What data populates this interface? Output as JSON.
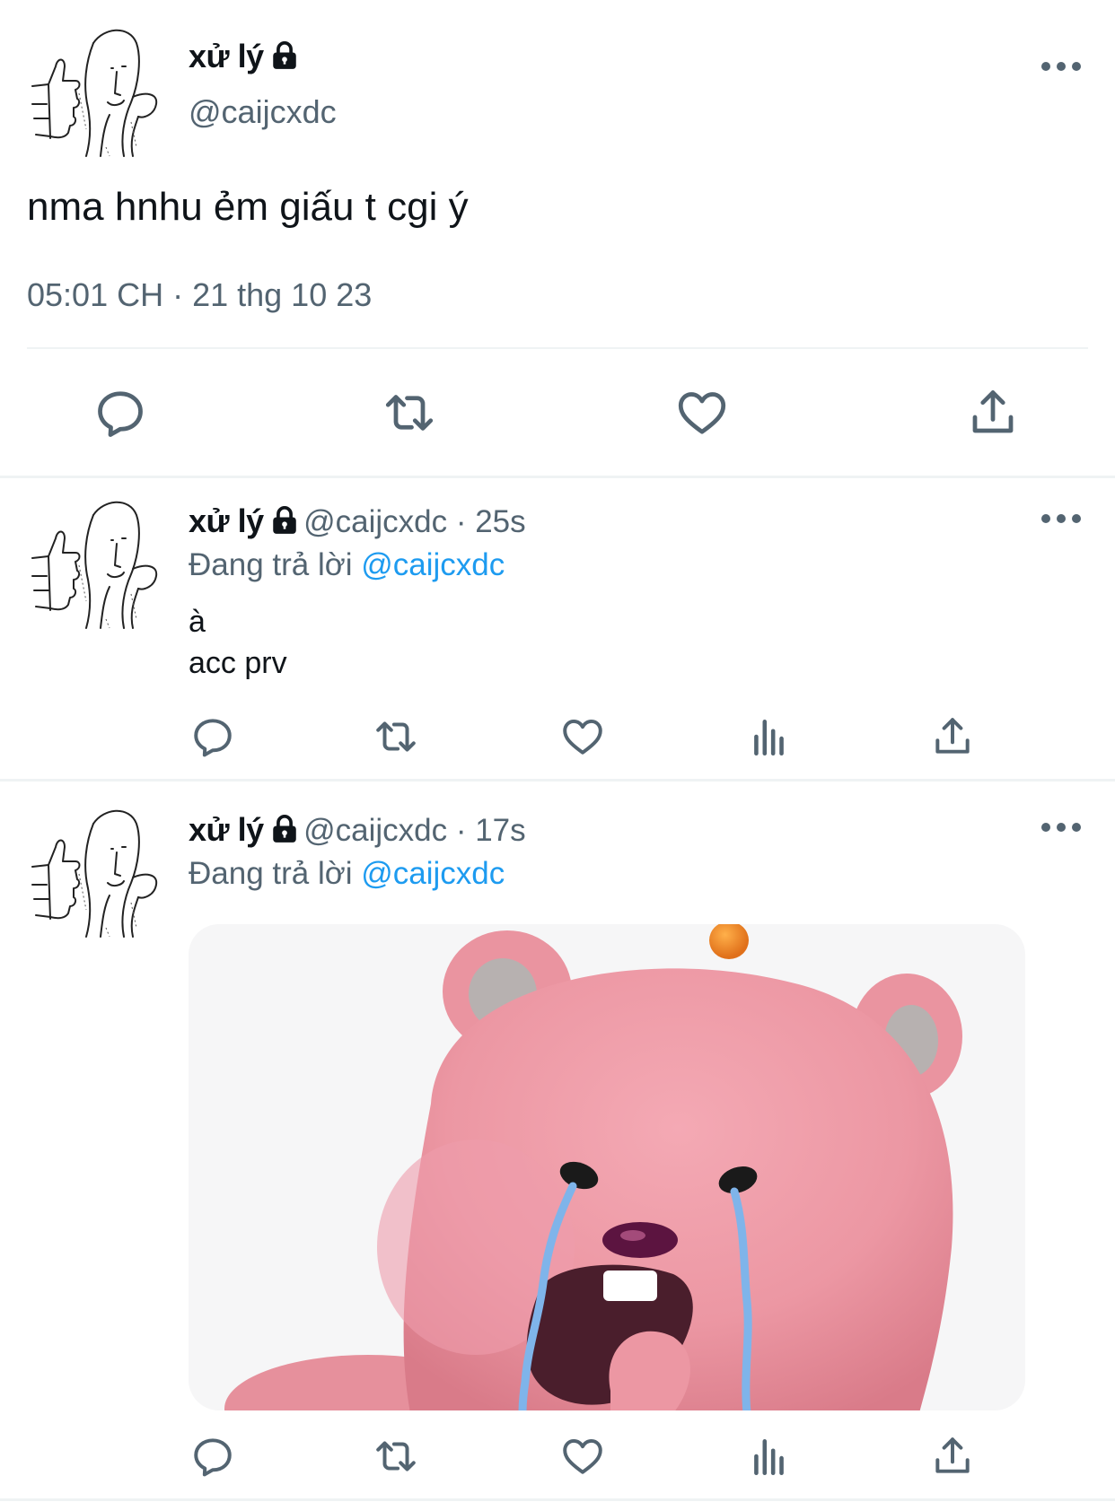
{
  "main_tweet": {
    "display_name": "xử lý",
    "handle": "@caijcxdc",
    "text": "nma hnhu ẻm giấu t cgi ý",
    "time": "05:01 CH",
    "date": "21 thg 10 23"
  },
  "replies": [
    {
      "display_name": "xử lý",
      "handle": "@caijcxdc",
      "age": "25s",
      "replying_prefix": "Đang trả lời",
      "replying_to": "@caijcxdc",
      "text_lines": [
        "à",
        "acc prv"
      ]
    },
    {
      "display_name": "xử lý",
      "handle": "@caijcxdc",
      "age": "17s",
      "replying_prefix": "Đang trả lời",
      "replying_to": "@caijcxdc",
      "media": "pink-cartoon-beaver-crying-image"
    }
  ],
  "colors": {
    "text_primary": "#0f1419",
    "text_secondary": "#536471",
    "link": "#1d9bf0",
    "divider": "#eff3f4"
  },
  "icons": [
    "lock-icon",
    "more-icon",
    "reply-icon",
    "retweet-icon",
    "like-icon",
    "views-icon",
    "share-icon"
  ]
}
